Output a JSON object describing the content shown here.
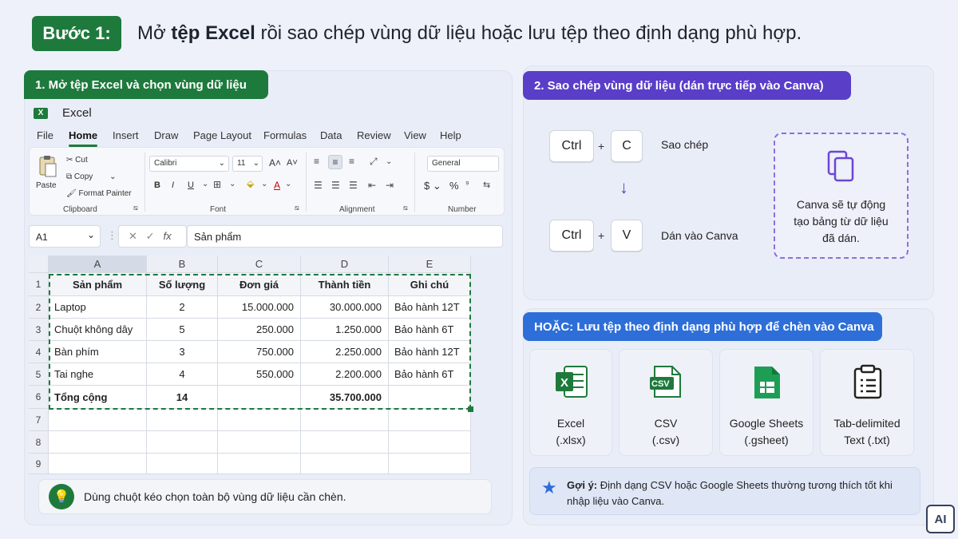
{
  "header": {
    "step": "Bước 1:",
    "title_pre": "Mở ",
    "title_bold": "tệp Excel",
    "title_post": " rồi sao chép vùng dữ liệu hoặc lưu tệp theo định dạng phù hợp."
  },
  "left": {
    "label": "1. Mở tệp Excel và chọn vùng dữ liệu",
    "app_icon": "X",
    "app_name": "Excel",
    "menu": [
      "File",
      "Home",
      "Insert",
      "Draw",
      "Page Layout",
      "Formulas",
      "Data",
      "Review",
      "View",
      "Help"
    ],
    "ribbon": {
      "paste": "Paste",
      "cut": "Cut",
      "copy": "Copy",
      "format_painter": "Format Painter",
      "clipboard": "Clipboard",
      "font_name": "Calibri",
      "font_size": "11",
      "font": "Font",
      "alignment": "Alignment",
      "number_format": "General",
      "number": "Number",
      "bold": "B",
      "italic": "I",
      "underline": "U",
      "grow": "A",
      "shrink": "A",
      "font_color": "A",
      "currency": "$",
      "percent": "%"
    },
    "name_box": "A1",
    "fx": "fx",
    "formula": "Sản phẩm",
    "columns": [
      "A",
      "B",
      "C",
      "D",
      "E"
    ],
    "rows": [
      "1",
      "2",
      "3",
      "4",
      "5",
      "6",
      "7",
      "8",
      "9"
    ],
    "table_header": [
      "Sản phẩm",
      "Số lượng",
      "Đơn giá",
      "Thành tiền",
      "Ghi chú"
    ],
    "table_rows": [
      [
        "Laptop",
        "2",
        "15.000.000",
        "30.000.000",
        "Bảo hành 12T"
      ],
      [
        "Chuột không dây",
        "5",
        "250.000",
        "1.250.000",
        "Bảo hành 6T"
      ],
      [
        "Bàn phím",
        "3",
        "750.000",
        "2.250.000",
        "Bảo hành 12T"
      ],
      [
        "Tai nghe",
        "4",
        "550.000",
        "2.200.000",
        "Bảo hành 6T"
      ]
    ],
    "total_row": [
      "Tổng cộng",
      "14",
      "",
      "35.700.000",
      ""
    ],
    "tip": "Dùng chuột kéo chọn toàn bộ vùng dữ liệu cần chèn."
  },
  "right_top": {
    "label": "2. Sao chép vùng dữ liệu (dán trực tiếp vào Canva)",
    "key_ctrl": "Ctrl",
    "key_c": "C",
    "key_v": "V",
    "plus": "+",
    "copy_desc": "Sao chép",
    "paste_desc": "Dán vào Canva",
    "canva_note_1": "Canva sẽ tự động",
    "canva_note_2": "tạo bảng từ dữ liệu",
    "canva_note_3": "đã dán."
  },
  "right_bottom": {
    "label": "HOẶC: Lưu tệp theo định dạng phù hợp để chèn vào Canva",
    "formats": [
      {
        "name": "Excel",
        "ext": "(.xlsx)",
        "icon": "excel-file-icon"
      },
      {
        "name": "CSV",
        "ext": "(.csv)",
        "icon": "csv-file-icon"
      },
      {
        "name": "Google Sheets",
        "ext": "(.gsheet)",
        "icon": "google-sheets-icon"
      },
      {
        "name": "Tab-delimited",
        "ext": "Text (.txt)",
        "icon": "clipboard-list-icon"
      }
    ],
    "csv_tag": "CSV",
    "xl_tag": "X",
    "hint_bold": "Gợi ý:",
    "hint_text": " Định dạng CSV hoặc Google Sheets thường tương thích tốt khi nhập liệu vào Canva."
  },
  "badge": "AI",
  "colors": {
    "green": "#1e7a3c",
    "purple": "#5a3ec8",
    "blue": "#2e6ed8"
  }
}
